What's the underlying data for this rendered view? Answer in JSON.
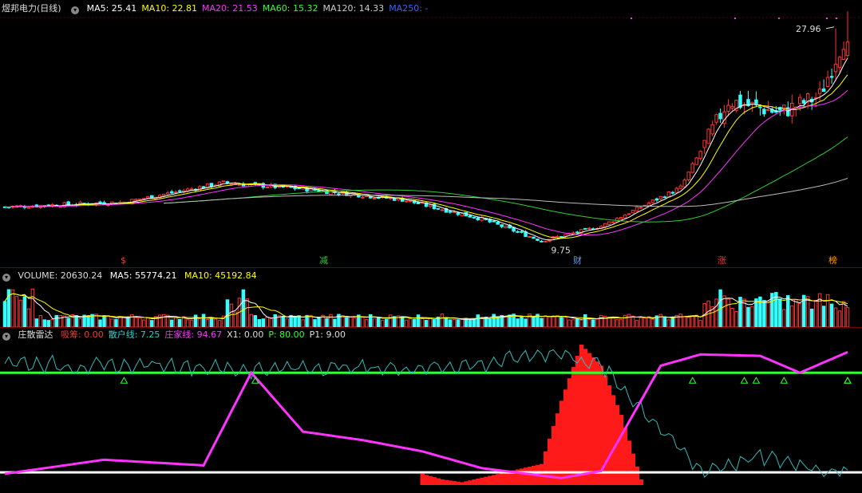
{
  "main": {
    "title": "煜邦电力(日线)",
    "ma": [
      {
        "label": "MA5: 25.41",
        "color": "#ffffff"
      },
      {
        "label": "MA10: 22.81",
        "color": "#ffff00"
      },
      {
        "label": "MA20: 21.53",
        "color": "#ff33ff"
      },
      {
        "label": "MA60: 15.32",
        "color": "#33ff33"
      },
      {
        "label": "MA120: 14.33",
        "color": "#cccccc"
      },
      {
        "label": "MA250: -",
        "color": "#3366ff"
      }
    ],
    "high_label": "27.96",
    "low_label": "9.75",
    "markers": [
      {
        "text": "$",
        "color": "#ff3333"
      },
      {
        "text": "减",
        "color": "#33cc33"
      },
      {
        "text": "财",
        "color": "#6699ff"
      },
      {
        "text": "涨",
        "color": "#ff3333"
      },
      {
        "text": "榜",
        "color": "#ff9900"
      }
    ]
  },
  "volume": {
    "title": "VOLUME: 20630.24",
    "ma5": "MA5: 55774.21",
    "ma10": "MA10: 45192.84"
  },
  "indicator": {
    "title": "庄散雷达",
    "items": [
      {
        "label": "吸筹: 0.00",
        "color": "#ff3333"
      },
      {
        "label": "散户线: 7.25",
        "color": "#33cccc"
      },
      {
        "label": "庄家线: 94.67",
        "color": "#ff33ff"
      },
      {
        "label": "X1: 0.00",
        "color": "#dddddd"
      },
      {
        "label": "P: 80.00",
        "color": "#33ff33"
      },
      {
        "label": "P1: 9.00",
        "color": "#dddddd"
      }
    ]
  },
  "colors": {
    "up": "#ff3333",
    "down": "#33ffff",
    "ma5": "#ffffff",
    "ma10": "#ffff00",
    "ma20": "#ff33ff",
    "ma60": "#33cc33",
    "ma120": "#bbbbbb",
    "retail_line": "#33bbbb",
    "dealer_line": "#ff33ff",
    "p_line": "#33ff33",
    "p1_line": "#ffffff",
    "accum_bar": "#ff1a1a"
  },
  "chart_data": [
    {
      "type": "candlestick",
      "title": "煜邦电力(日线)",
      "annotations": [
        "27.96",
        "9.75"
      ],
      "trend_keypoints": [
        {
          "bar": 0,
          "close": 13.2
        },
        {
          "bar": 30,
          "close": 13.6
        },
        {
          "bar": 55,
          "close": 15.2
        },
        {
          "bar": 75,
          "close": 14.7
        },
        {
          "bar": 100,
          "close": 13.8
        },
        {
          "bar": 120,
          "close": 12.2
        },
        {
          "bar": 135,
          "close": 10.4
        },
        {
          "bar": 150,
          "close": 11.6
        },
        {
          "bar": 170,
          "close": 14.8
        },
        {
          "bar": 182,
          "close": 22.0
        },
        {
          "bar": 195,
          "close": 21.0
        },
        {
          "bar": 205,
          "close": 22.4
        },
        {
          "bar": 212,
          "close": 27.96
        }
      ]
    },
    {
      "type": "bar",
      "title": "VOLUME",
      "series": [
        {
          "name": "VOLUME",
          "values": [
            20630.24
          ]
        },
        {
          "name": "MA5",
          "values": [
            55774.21
          ]
        },
        {
          "name": "MA10",
          "values": [
            45192.84
          ]
        }
      ]
    },
    {
      "type": "line",
      "title": "庄散雷达",
      "series": [
        {
          "name": "P",
          "values": [
            80.0
          ]
        },
        {
          "name": "P1",
          "values": [
            9.0
          ]
        },
        {
          "name": "散户线",
          "x": [
            0,
            20,
            40,
            60,
            80,
            100,
            120,
            138,
            150,
            160,
            175,
            190,
            200,
            212
          ],
          "values": [
            88,
            84,
            86,
            82,
            84,
            83,
            86,
            95,
            85,
            55,
            10,
            20,
            15,
            7.25
          ]
        },
        {
          "name": "庄家线",
          "x": [
            0,
            25,
            50,
            62,
            75,
            90,
            105,
            120,
            140,
            150,
            165,
            175,
            190,
            200,
            212
          ],
          "values": [
            8,
            18,
            14,
            80,
            38,
            32,
            24,
            12,
            5,
            10,
            85,
            93,
            92,
            80,
            94.67
          ]
        },
        {
          "name": "吸筹",
          "x": [
            105,
            110,
            115,
            135,
            140,
            145,
            150,
            155,
            160
          ],
          "values": [
            8,
            4,
            2,
            15,
            60,
            100,
            85,
            50,
            4
          ]
        }
      ]
    }
  ]
}
